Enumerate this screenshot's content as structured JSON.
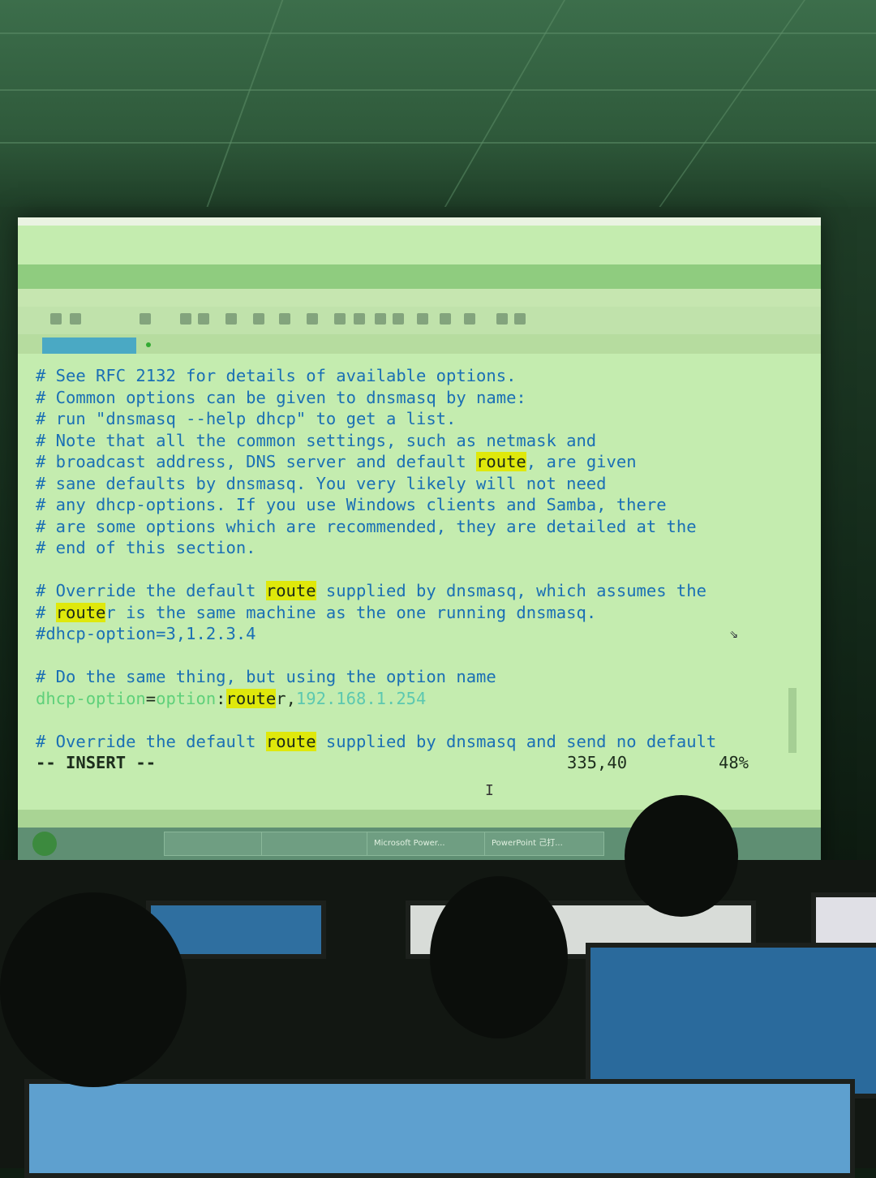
{
  "terminal": {
    "lines": [
      {
        "t": "# See RFC 2132 for details of available options."
      },
      {
        "t": "# Common options can be given to dnsmasq by name:"
      },
      {
        "t": "# run \"dnsmasq --help dhcp\" to get a list."
      },
      {
        "t": "# Note that all the common settings, such as netmask and"
      },
      {
        "pre": "# broadcast address, DNS server and default ",
        "hl": "route",
        "post": ", are given"
      },
      {
        "t": "# sane defaults by dnsmasq. You very likely will not need"
      },
      {
        "t": "# any dhcp-options. If you use Windows clients and Samba, there"
      },
      {
        "t": "# are some options which are recommended, they are detailed at the"
      },
      {
        "t": "# end of this section."
      },
      {
        "t": ""
      },
      {
        "pre": "# Override the default ",
        "hl": "route",
        "post": " supplied by dnsmasq, which assumes the"
      },
      {
        "pre": "# ",
        "hl": "route",
        "post": "r is the same machine as the one running dnsmasq."
      },
      {
        "t": "#dhcp-option=3,1.2.3.4"
      },
      {
        "t": ""
      },
      {
        "t": "# Do the same thing, but using the option name"
      }
    ],
    "option_line": {
      "key": "dhcp-option",
      "eq": "=",
      "val": "option",
      "colon": ":",
      "hl": "route",
      "after": "r",
      "comma": ",",
      "ip": "192.168.1.254"
    },
    "last_line": {
      "pre": "# Override the default ",
      "hl": "route",
      "post": " supplied by dnsmasq and send no default"
    },
    "status": {
      "mode": "-- INSERT --",
      "position": "335,40",
      "percent": "48%"
    }
  },
  "taskbar": {
    "items": [
      "Microsoft Power...",
      "PowerPoint 己打..."
    ]
  },
  "colors": {
    "comment": "#1a6fb5",
    "highlight": "#dfe80b",
    "option": "#5fd07a",
    "ip": "#5cc8b0"
  }
}
